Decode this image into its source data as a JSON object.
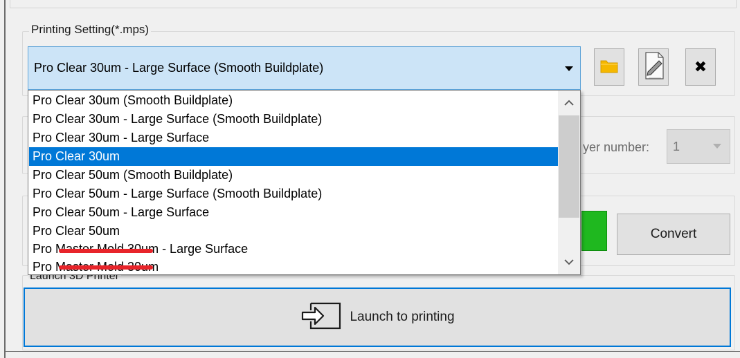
{
  "printing_setting": {
    "legend": "Printing Setting(*.mps)",
    "selected_value": "Pro Clear 30um - Large Surface (Smooth Buildplate)",
    "options": [
      "Pro Clear 30um (Smooth Buildplate)",
      "Pro Clear 30um - Large Surface (Smooth Buildplate)",
      "Pro Clear 30um - Large Surface",
      "Pro Clear 30um",
      "Pro Clear 50um (Smooth Buildplate)",
      "Pro Clear 50um - Large Surface (Smooth Buildplate)",
      "Pro Clear 50um - Large Surface",
      "Pro Clear 50um",
      "Pro Master Mold 30um - Large Surface",
      "Pro Master Mold 30um"
    ],
    "highlighted_index": 3
  },
  "toolbar": {
    "open_icon": "folder-icon",
    "edit_icon": "edit-document-icon",
    "delete_icon": "close-icon"
  },
  "layer": {
    "label": "yer number:",
    "value": "1"
  },
  "convert": {
    "button_label": "Convert"
  },
  "launch": {
    "legend": "Launch 3D Printer",
    "button_label": "Launch to printing",
    "icon": "import-arrow-icon"
  },
  "colors": {
    "accent": "#0078d7",
    "combo_bg": "#cce4f7",
    "green": "#1fb81f",
    "redaction": "#e8242a"
  }
}
